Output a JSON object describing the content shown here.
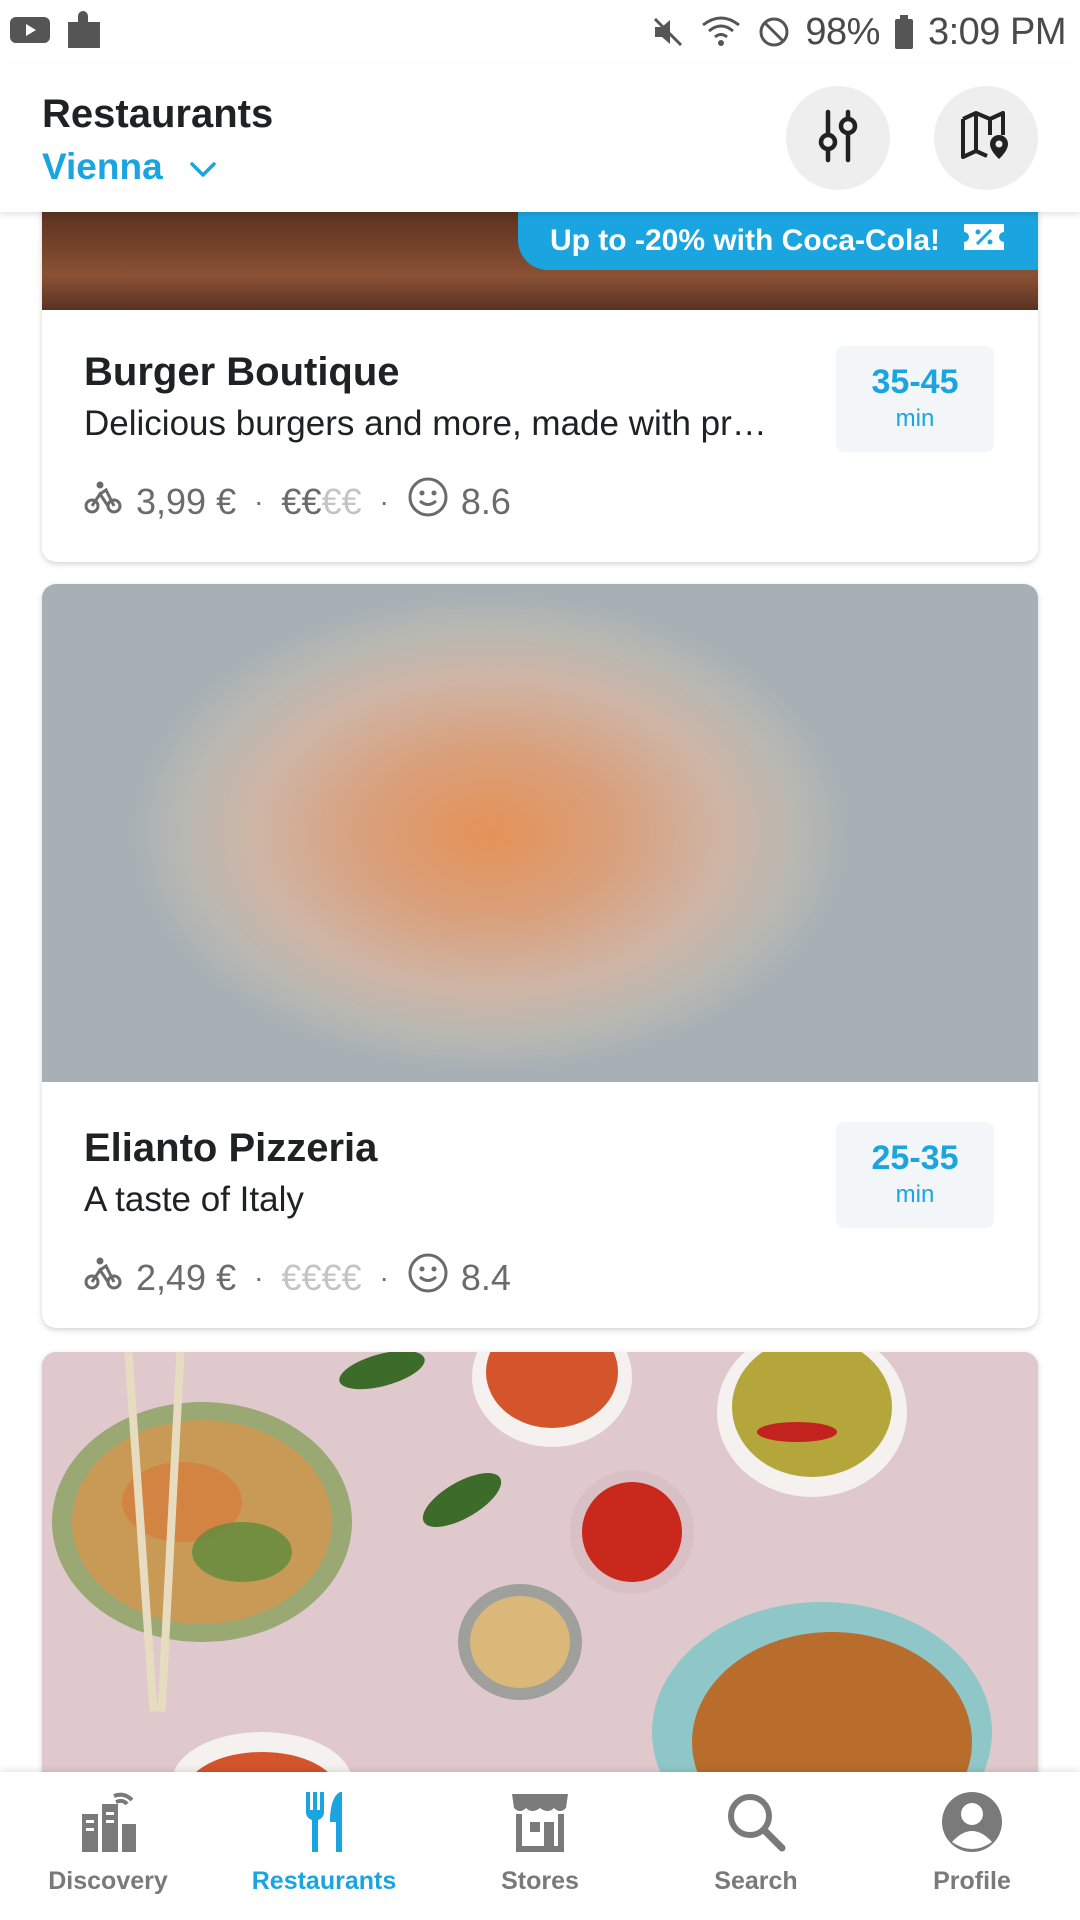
{
  "status_bar": {
    "battery": "98%",
    "time": "3:09 PM",
    "icons": [
      "youtube-icon",
      "puzzle-icon",
      "mute-icon",
      "wifi-icon",
      "do-not-disturb-icon",
      "battery-icon"
    ]
  },
  "header": {
    "title": "Restaurants",
    "location": "Vienna",
    "buttons": [
      "filter-icon",
      "map-icon"
    ]
  },
  "restaurants": [
    {
      "name": "Burger Boutique",
      "description": "Delicious burgers and more, made with pr…",
      "delivery_fee": "3,99 €",
      "price_active": "€€",
      "price_inactive": "€€",
      "rating": "8.6",
      "eta_range": "35-45",
      "eta_unit": "min",
      "promo": "Up to -20% with Coca-Cola!"
    },
    {
      "name": "Elianto Pizzeria",
      "description": "A taste of Italy",
      "delivery_fee": "2,49 €",
      "price_active": "",
      "price_inactive": "€€€€",
      "rating": "8.4",
      "eta_range": "25-35",
      "eta_unit": "min"
    }
  ],
  "separator": "·",
  "bottom_nav": [
    {
      "label": "Discovery",
      "icon": "discovery-icon"
    },
    {
      "label": "Restaurants",
      "icon": "fork-knife-icon",
      "active": true
    },
    {
      "label": "Stores",
      "icon": "store-icon"
    },
    {
      "label": "Search",
      "icon": "search-icon"
    },
    {
      "label": "Profile",
      "icon": "profile-icon"
    }
  ],
  "colors": {
    "accent": "#1aa4e0",
    "text": "#202125",
    "muted": "#6b6b6b"
  }
}
